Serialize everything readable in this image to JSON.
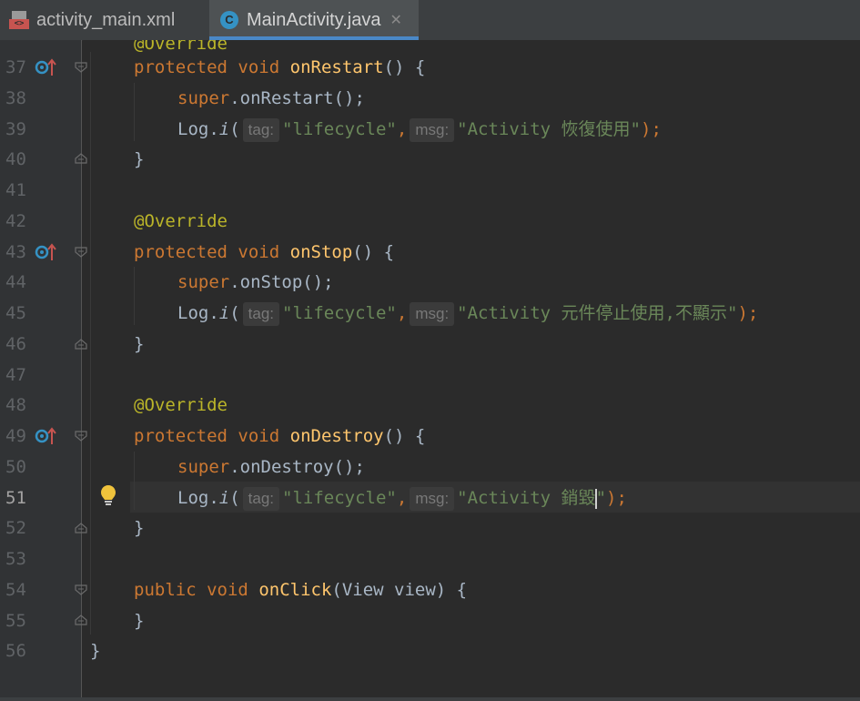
{
  "tabs": [
    {
      "label": "activity_main.xml",
      "icon": "xml-file-icon",
      "active": false
    },
    {
      "label": "MainActivity.java",
      "icon": "java-class-icon",
      "active": true,
      "icon_letter": "C"
    }
  ],
  "gutter": {
    "line_numbers": [
      "37",
      "38",
      "39",
      "40",
      "41",
      "42",
      "43",
      "44",
      "45",
      "46",
      "47",
      "48",
      "49",
      "50",
      "51",
      "52",
      "53",
      "54",
      "55",
      "56"
    ],
    "current_line": "51"
  },
  "code": {
    "l37": {
      "kw1": "protected",
      "kw2": "void",
      "name": "onRestart",
      "rest": "() {"
    },
    "l38": {
      "kw": "super",
      "rest": ".onRestart();"
    },
    "l39": {
      "log": "Log.",
      "method": "i",
      "open": "(",
      "tag_hint": "tag:",
      "tag_value": "\"lifecycle\"",
      "comma": ",",
      "msg_hint": "msg:",
      "msg_value": "\"Activity 恢復使用\"",
      "close": ");"
    },
    "l40": {
      "text": "}"
    },
    "l42": {
      "ann": "@Override"
    },
    "l43": {
      "kw1": "protected",
      "kw2": "void",
      "name": "onStop",
      "rest": "() {"
    },
    "l44": {
      "kw": "super",
      "rest": ".onStop();"
    },
    "l45": {
      "log": "Log.",
      "method": "i",
      "open": "(",
      "tag_hint": "tag:",
      "tag_value": "\"lifecycle\"",
      "comma": ",",
      "msg_hint": "msg:",
      "msg_value": "\"Activity 元件停止使用,不顯示\"",
      "close": ");"
    },
    "l46": {
      "text": "}"
    },
    "l48": {
      "ann": "@Override"
    },
    "l49": {
      "kw1": "protected",
      "kw2": "void",
      "name": "onDestroy",
      "rest": "() {"
    },
    "l50": {
      "kw": "super",
      "rest": ".onDestroy();"
    },
    "l51": {
      "log": "Log.",
      "method": "i",
      "open": "(",
      "tag_hint": "tag:",
      "tag_value": "\"lifecycle\"",
      "comma": ",",
      "msg_hint": "msg:",
      "msg_before_caret": "\"Activity 銷毀",
      "msg_after_caret": "\"",
      "close": ");"
    },
    "l52": {
      "text": "}"
    },
    "l54": {
      "kw1": "public",
      "kw2": "void",
      "name": "onClick",
      "rest": "(View view) {"
    },
    "l55": {
      "text": "}"
    },
    "l56": {
      "text": "}"
    }
  },
  "colors": {
    "background": "#2b2b2b",
    "keyword": "#cc7832",
    "method_name": "#ffc66d",
    "annotation": "#bbb529",
    "string": "#6a8759",
    "tab_underline": "#4a88c7"
  }
}
